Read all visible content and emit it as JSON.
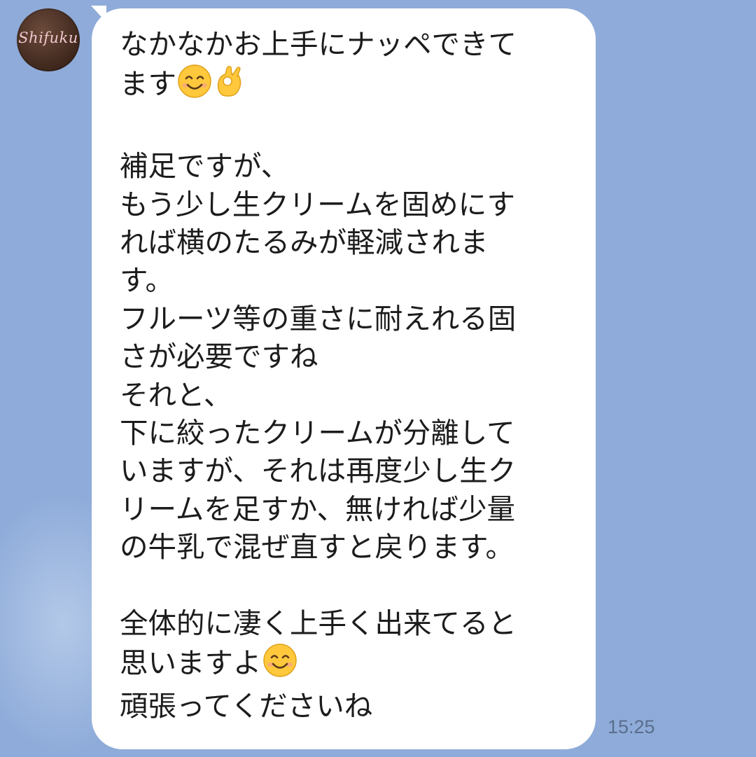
{
  "chat": {
    "sender": {
      "avatar_text": "Shifuku"
    },
    "message": {
      "lines": [
        "なかなかお上手にナッペできて",
        "ます",
        "",
        "補足ですが、",
        "もう少し生クリームを固めにす",
        "れば横のたるみが軽減されま",
        "す。",
        "フルーツ等の重さに耐えれる固",
        "さが必要ですね",
        "それと、",
        "下に絞ったクリームが分離して",
        "いますが、それは再度少し生ク",
        "リームを足すか、無ければ少量",
        "の牛乳で混ぜ直すと戻ります。",
        "",
        "全体的に凄く上手く出来てると",
        "思いますよ",
        "頑張ってくださいね"
      ],
      "emojis": {
        "line2": [
          "smiling-face-icon",
          "ok-hand-icon"
        ],
        "line17": [
          "smiling-face-icon"
        ]
      },
      "timestamp": "15:25"
    }
  },
  "colors": {
    "background": "#8eabd9",
    "bubble": "#ffffff",
    "text": "#1c1c1c",
    "timestamp": "#5a6e8c"
  }
}
